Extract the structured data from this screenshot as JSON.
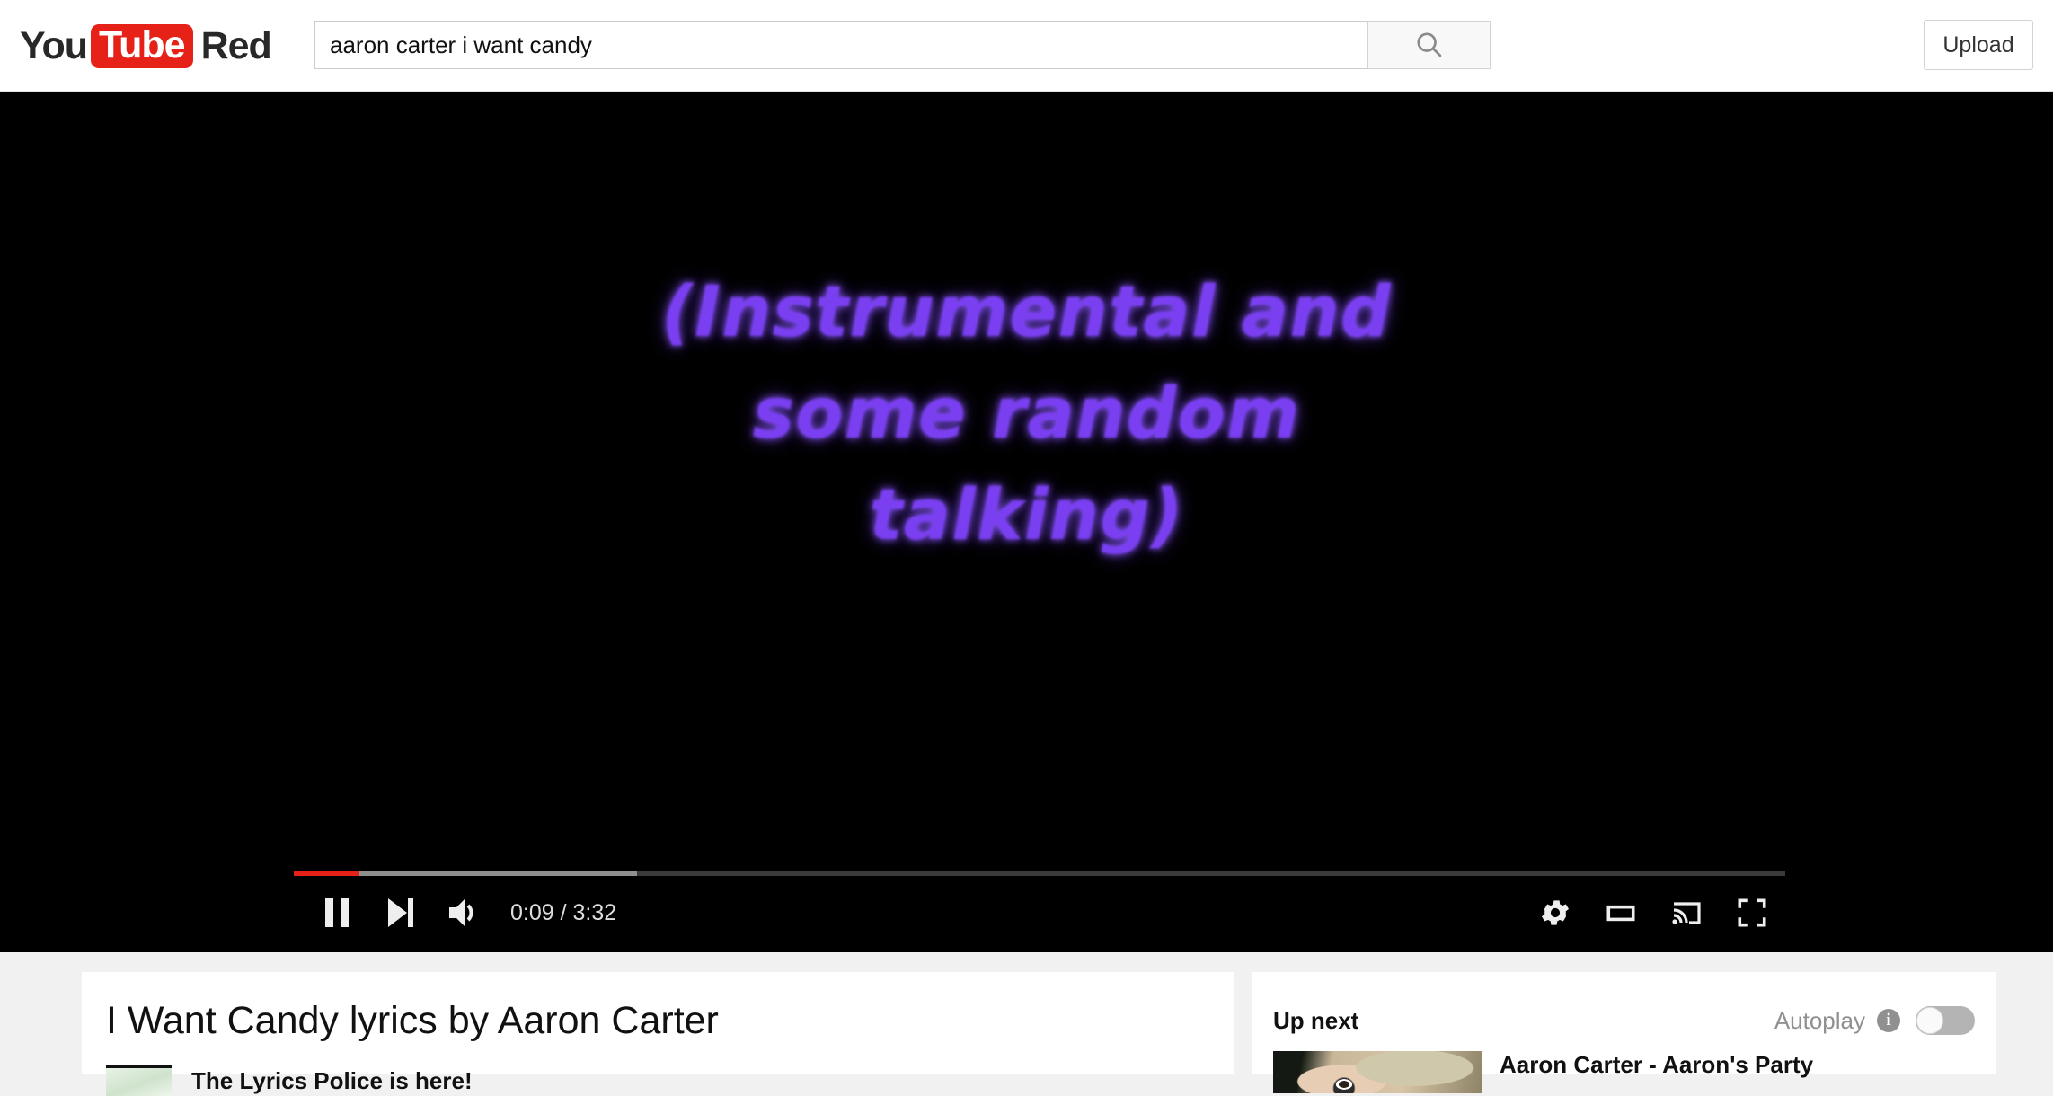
{
  "header": {
    "logo": {
      "you": "You",
      "tube": "Tube",
      "red": "Red"
    },
    "search": {
      "value": "aaron carter i want candy",
      "placeholder": "Search",
      "button_icon": "search-icon"
    },
    "upload_label": "Upload"
  },
  "player": {
    "caption_lines": [
      "(Instrumental and",
      "some random",
      "talking)"
    ],
    "caption_color": "#7b3ff2",
    "time_display": "0:09 / 3:32",
    "current_time": "0:09",
    "duration": "3:32",
    "progress_played_percent": 4.4,
    "progress_loaded_percent": 23.0,
    "accent_color": "#e62117",
    "controls": {
      "pause": "pause-icon",
      "next": "next-video-icon",
      "volume": "volume-icon",
      "settings": "gear-icon",
      "miniplayer": "miniplayer-icon",
      "cast": "cast-icon",
      "fullscreen": "fullscreen-icon"
    }
  },
  "primary": {
    "title": "I Want Candy lyrics by Aaron Carter",
    "channel_name": "The Lyrics Police is here!"
  },
  "secondary": {
    "up_next_label": "Up next",
    "autoplay_label": "Autoplay",
    "autoplay_info": "i",
    "autoplay_on": false,
    "items": [
      {
        "title": "Aaron Carter - Aaron's Party"
      }
    ]
  }
}
